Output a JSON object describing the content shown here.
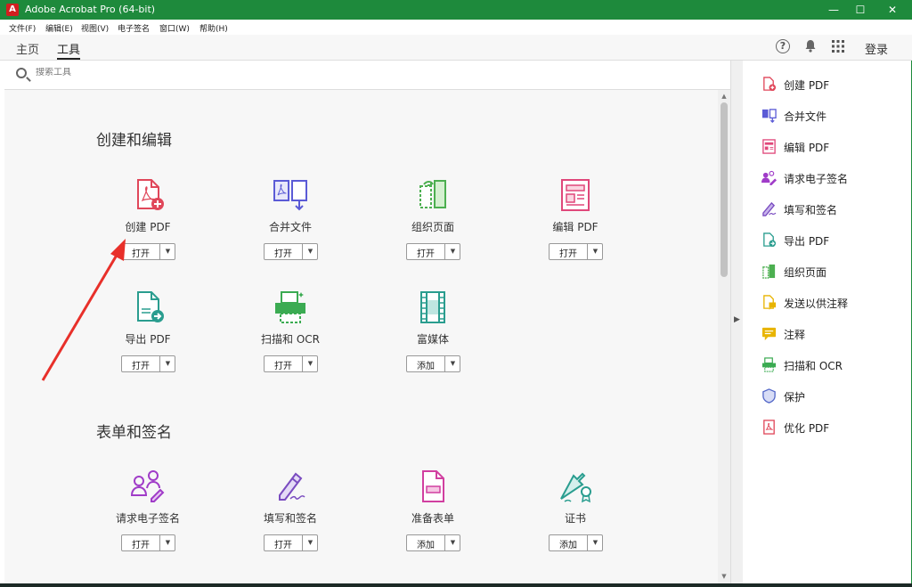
{
  "titlebar": {
    "title": "Adobe Acrobat Pro (64-bit)",
    "minimize": "—",
    "maximize": "☐",
    "close": "✕"
  },
  "menu": [
    "文件(F)",
    "编辑(E)",
    "视图(V)",
    "电子签名",
    "窗口(W)",
    "帮助(H)"
  ],
  "tabs": {
    "home": "主页",
    "tools": "工具",
    "login": "登录"
  },
  "search": {
    "placeholder": "搜索工具"
  },
  "sections": [
    {
      "title": "创建和编辑"
    },
    {
      "title": "表单和签名"
    }
  ],
  "tools": [
    {
      "name": "创建 PDF",
      "button": "打开"
    },
    {
      "name": "合并文件",
      "button": "打开"
    },
    {
      "name": "组织页面",
      "button": "打开"
    },
    {
      "name": "编辑 PDF",
      "button": "打开"
    },
    {
      "name": "导出 PDF",
      "button": "打开"
    },
    {
      "name": "扫描和 OCR",
      "button": "打开"
    },
    {
      "name": "富媒体",
      "button": "添加"
    },
    {
      "name": "请求电子签名",
      "button": "打开"
    },
    {
      "name": "填写和签名",
      "button": "打开"
    },
    {
      "name": "准备表单",
      "button": "添加"
    },
    {
      "name": "证书",
      "button": "添加"
    }
  ],
  "right_panel": [
    {
      "label": "创建 PDF",
      "icon": "create-pdf-icon",
      "color": "#e0475a"
    },
    {
      "label": "合并文件",
      "icon": "combine-files-icon",
      "color": "#5b5bd6"
    },
    {
      "label": "编辑 PDF",
      "icon": "edit-pdf-icon",
      "color": "#e0477a"
    },
    {
      "label": "请求电子签名",
      "icon": "request-signature-icon",
      "color": "#a03cc8"
    },
    {
      "label": "填写和签名",
      "icon": "fill-sign-icon",
      "color": "#7a4cc0"
    },
    {
      "label": "导出 PDF",
      "icon": "export-pdf-icon",
      "color": "#2a9d8f"
    },
    {
      "label": "组织页面",
      "icon": "organize-pages-icon",
      "color": "#4caf50"
    },
    {
      "label": "发送以供注释",
      "icon": "send-comments-icon",
      "color": "#e8b400"
    },
    {
      "label": "注释",
      "icon": "comment-icon",
      "color": "#e8b400"
    },
    {
      "label": "扫描和 OCR",
      "icon": "scan-ocr-icon",
      "color": "#3bab52"
    },
    {
      "label": "保护",
      "icon": "protect-icon",
      "color": "#5468c8"
    },
    {
      "label": "优化 PDF",
      "icon": "optimize-pdf-icon",
      "color": "#e0475a"
    }
  ],
  "colors": {
    "titlebar": "#1e8a3c",
    "annotation_arrow": "#e8302a"
  }
}
